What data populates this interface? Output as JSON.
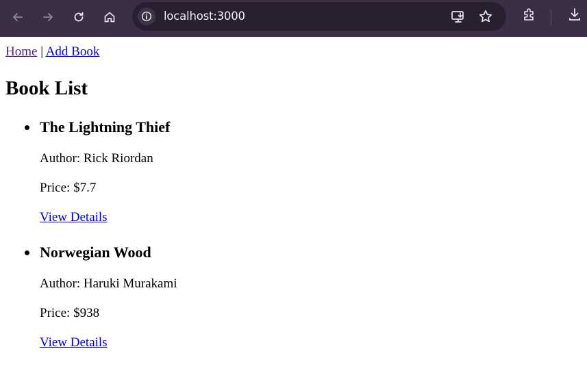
{
  "browser": {
    "url": "localhost:3000",
    "icons": [
      "back-icon",
      "forward-icon",
      "reload-icon",
      "home-icon",
      "site-info-icon",
      "install-app-icon",
      "bookmark-star-icon",
      "extensions-icon",
      "download-icon"
    ]
  },
  "nav": {
    "home_label": "Home",
    "separator": "|",
    "add_book_label": "Add Book"
  },
  "page": {
    "title": "Book List"
  },
  "books": [
    {
      "title": "The Lightning Thief",
      "author": "Author: Rick Riordan",
      "price": "Price: $7.7",
      "link_label": "View Details"
    },
    {
      "title": "Norwegian Wood",
      "author": "Author: Haruki Murakami",
      "price": "Price: $938",
      "link_label": "View Details"
    }
  ]
}
